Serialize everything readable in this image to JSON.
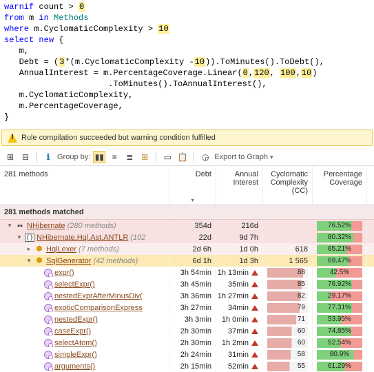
{
  "code": {
    "l1": {
      "a": "warnif",
      "b": " count > ",
      "c": "0"
    },
    "l2": {
      "a": "from",
      "b": " m ",
      "c": "in",
      "d": " Methods"
    },
    "l3": {
      "a": "where",
      "b": " m.CyclomaticComplexity > ",
      "c": "10"
    },
    "l4": {
      "a": "select",
      "b": " ",
      "c": "new",
      "d": " {"
    },
    "l5": "   m,",
    "l6": {
      "a": "   Debt = (",
      "b": "3",
      "c": "*(m.CyclomaticComplexity -",
      "d": "10",
      "e": ")).ToMinutes().ToDebt(),"
    },
    "l7": {
      "a": "   AnnualInterest = m.PercentageCoverage.Linear(",
      "b": "0",
      "c": ",",
      "d": "120",
      "e": ", ",
      "f": "100",
      "g": ",",
      "h": "10",
      "i": ")"
    },
    "l8": "                     .ToMinutes().ToAnnualInterest(),",
    "l9": "   m.CyclomaticComplexity,",
    "l10": "   m.PercentageCoverage,",
    "l11": "}"
  },
  "warning": "Rule compilation succeeded but warning condition fulfilled",
  "toolbar": {
    "group_by": "Group by:",
    "export": "Export to Graph"
  },
  "summary": "281 methods",
  "columns": {
    "debt": "Debt",
    "ai": "Annual\nInterest",
    "cc": "Cyclomatic\nComplexity\n(CC)",
    "cov": "Percentage\nCoverage"
  },
  "group_header": "281 methods matched",
  "rows": [
    {
      "kind": "asm",
      "depth": 0,
      "twist": "▾",
      "name": "NHibernate",
      "count": "(280 methods)",
      "debt": "354d",
      "ai": "216d",
      "cc": "",
      "cov": 76.52
    },
    {
      "kind": "ns",
      "depth": 1,
      "twist": "▾",
      "name": "NHibernate.Hql.Ast.ANTLR",
      "count": "(102",
      "debt": "22d",
      "ai": "9d 7h",
      "cc": "",
      "cov": 80.32
    },
    {
      "kind": "cls",
      "depth": 2,
      "twist": "▸",
      "name": "HqlLexer",
      "count": "(7 methods)",
      "debt": "2d 6h",
      "ai": "1d 0h",
      "cc": "618",
      "cov": 65.21
    },
    {
      "kind": "cls",
      "depth": 2,
      "twist": "▾",
      "name": "SqlGenerator",
      "count": "(42 methods)",
      "debt": "6d 1h",
      "ai": "1d 3h",
      "cc": "1 565",
      "cov": 69.47,
      "sel": true
    },
    {
      "kind": "meth",
      "depth": 3,
      "name": "expr()",
      "debt": "3h 54min",
      "ai": "1h 13min",
      "ai_tri": true,
      "cc": 88,
      "cov": 42.5
    },
    {
      "kind": "meth",
      "depth": 3,
      "name": "selectExpr()",
      "debt": "3h 45min",
      "ai": "35min",
      "ai_tri": true,
      "cc": 85,
      "cov": 76.92
    },
    {
      "kind": "meth",
      "depth": 3,
      "name": "nestedExprAfterMinusDiv(",
      "debt": "3h 36min",
      "ai": "1h 27min",
      "ai_tri": true,
      "cc": 82,
      "cov": 29.17
    },
    {
      "kind": "meth",
      "depth": 3,
      "name": "exoticComparisonExpress",
      "debt": "3h 27min",
      "ai": "34min",
      "ai_tri": true,
      "cc": 79,
      "cov": 77.31
    },
    {
      "kind": "meth",
      "depth": 3,
      "name": "nestedExpr()",
      "debt": "3h 3min",
      "ai": "1h 0min",
      "ai_tri": true,
      "cc": 71,
      "cov": 53.95
    },
    {
      "kind": "meth",
      "depth": 3,
      "name": "caseExpr()",
      "debt": "2h 30min",
      "ai": "37min",
      "ai_tri": true,
      "cc": 60,
      "cov": 74.85
    },
    {
      "kind": "meth",
      "depth": 3,
      "name": "selectAtom()",
      "debt": "2h 30min",
      "ai": "1h 2min",
      "ai_tri": true,
      "cc": 60,
      "cov": 52.54
    },
    {
      "kind": "meth",
      "depth": 3,
      "name": "simpleExpr()",
      "debt": "2h 24min",
      "ai": "31min",
      "ai_tri": true,
      "cc": 58,
      "cov": 80.9
    },
    {
      "kind": "meth",
      "depth": 3,
      "name": "arguments()",
      "debt": "2h 15min",
      "ai": "52min",
      "ai_tri": true,
      "cc": 55,
      "cov": 61.29
    }
  ],
  "chart_data": {
    "type": "table",
    "title": "281 methods matched",
    "columns": [
      "Method",
      "Debt",
      "Annual Interest",
      "Cyclomatic Complexity (CC)",
      "Percentage Coverage"
    ],
    "rows": [
      [
        "NHibernate (280 methods)",
        "354d",
        "216d",
        null,
        76.52
      ],
      [
        "NHibernate.Hql.Ast.ANTLR (102",
        "22d",
        "9d 7h",
        null,
        80.32
      ],
      [
        "HqlLexer (7 methods)",
        "2d 6h",
        "1d 0h",
        618,
        65.21
      ],
      [
        "SqlGenerator (42 methods)",
        "6d 1h",
        "1d 3h",
        1565,
        69.47
      ],
      [
        "expr()",
        "3h 54min",
        "1h 13min",
        88,
        42.5
      ],
      [
        "selectExpr()",
        "3h 45min",
        "35min",
        85,
        76.92
      ],
      [
        "nestedExprAfterMinusDiv(",
        "3h 36min",
        "1h 27min",
        82,
        29.17
      ],
      [
        "exoticComparisonExpress",
        "3h 27min",
        "34min",
        79,
        77.31
      ],
      [
        "nestedExpr()",
        "3h 3min",
        "1h 0min",
        71,
        53.95
      ],
      [
        "caseExpr()",
        "2h 30min",
        "37min",
        60,
        74.85
      ],
      [
        "selectAtom()",
        "2h 30min",
        "1h 2min",
        60,
        52.54
      ],
      [
        "simpleExpr()",
        "2h 24min",
        "31min",
        58,
        80.9
      ],
      [
        "arguments()",
        "2h 15min",
        "52min",
        55,
        61.29
      ]
    ]
  }
}
